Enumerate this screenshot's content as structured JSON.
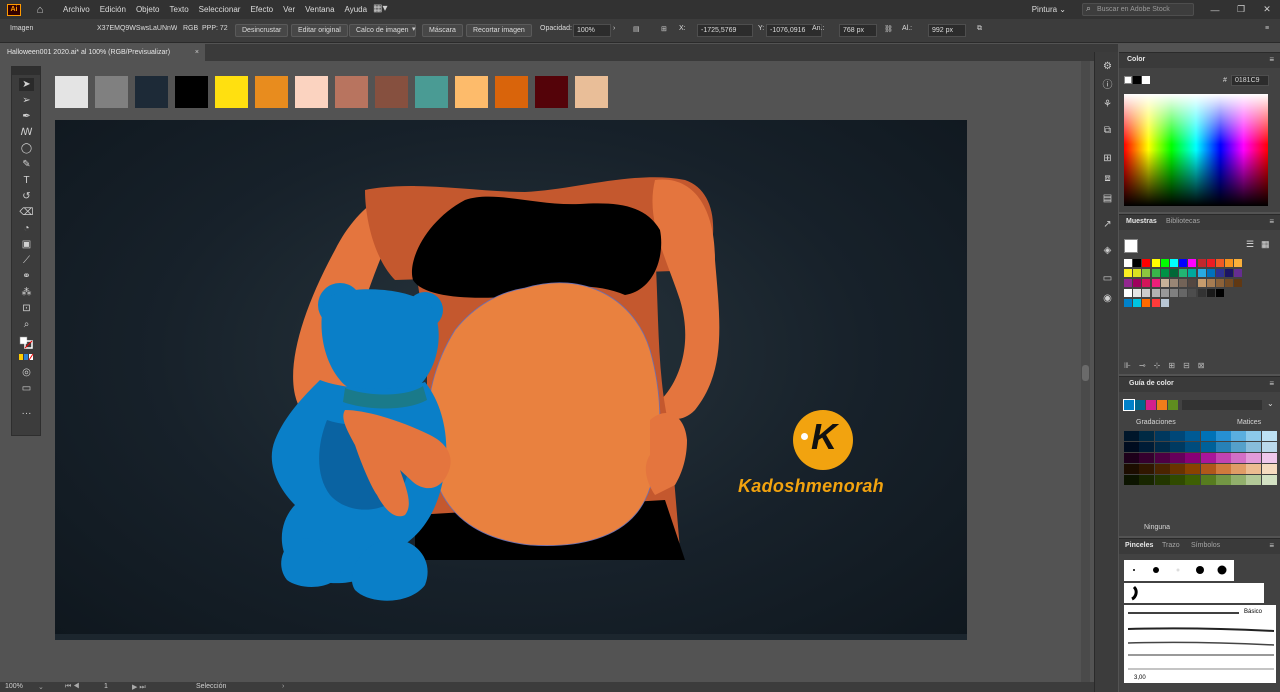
{
  "menubar": {
    "app_logo": "Ai",
    "items": [
      "Archivo",
      "Edición",
      "Objeto",
      "Texto",
      "Seleccionar",
      "Efecto",
      "Ver",
      "Ventana",
      "Ayuda"
    ],
    "workspace": "Pintura ⌄",
    "stock_placeholder": "Buscar en Adobe Stock",
    "window_buttons": [
      "—",
      "❐",
      "✕"
    ]
  },
  "controlbar": {
    "selection_type": "Imagen",
    "filename": "X37EMQ9WSwsLaUNnWj...",
    "color_mode": "RGB",
    "ppp": "PPP: 72",
    "embed_button": "Desincrustar",
    "edit_original_button": "Editar original",
    "trace_button": "Calco de imagen",
    "mask_button": "Máscara",
    "crop_button": "Recortar imagen",
    "opacity_label": "Opacidad:",
    "opacity_value": "100%",
    "x_label": "X:",
    "x_value": "-1725,5769",
    "y_label": "Y:",
    "y_value": "-1076,0916",
    "w_label": "An.:",
    "w_value": "768 px",
    "h_label": "Al.:",
    "h_value": "992 px"
  },
  "document_tab": {
    "title": "Halloween001 2020.ai* al 100% (RGB/Previsualizar)",
    "close": "×"
  },
  "tools": [
    "selection-tool",
    "direct-selection-tool",
    "pen-tool",
    "curvature-tool",
    "ellipse-tool",
    "pencil-tool",
    "type-tool",
    "rotate-tool",
    "eraser-tool",
    "shape-builder-tool",
    "gradient-tool",
    "eyedropper-tool",
    "blend-tool",
    "symbol-sprayer-tool",
    "artboard-tool",
    "zoom-tool",
    "fill-stroke",
    "color-mode",
    "draw-mode",
    "screen-mode",
    "more-tools"
  ],
  "artboard_swatches": [
    "#e4e4e4",
    "#808080",
    "#1d2a37",
    "#000000",
    "#ffe010",
    "#e88c1e",
    "#fbd3c0",
    "#b8745f",
    "#86503f",
    "#4a9b94",
    "#fdbb6b",
    "#d9640b",
    "#540309",
    "#e9be98"
  ],
  "illustration": {
    "brand_letter": "K",
    "brand_name": "Kadoshmenorah",
    "colors": {
      "skin": "#e4753e",
      "skin_shadow": "#c4582e",
      "belly": "#e9813f",
      "clothes": "#000000",
      "bear": "#0a7fc8",
      "bear_shadow": "#0a63a2",
      "brand": "#f2a30f"
    }
  },
  "statusbar": {
    "zoom": "100%",
    "artboard_number": "1",
    "tool_name": "Selección"
  },
  "color_panel": {
    "title": "Color",
    "hex_label": "#",
    "hex_value": "0181C9"
  },
  "swatches_panel": {
    "tab_active": "Muestras",
    "tab_inactive": "Bibliotecas",
    "rows": [
      [
        "#ffffff",
        "#000000",
        "#ff0000",
        "#ffff00",
        "#00ff00",
        "#00ffff",
        "#0000ff",
        "#ff00ff",
        "#c1272d",
        "#ed1c24",
        "#f15a24",
        "#f7931e",
        "#fbb03b"
      ],
      [
        "#fcee21",
        "#d9e021",
        "#8cc63f",
        "#39b54a",
        "#009245",
        "#006837",
        "#22b573",
        "#00a99d",
        "#29abe2",
        "#0071bc",
        "#2e3192",
        "#1b1464",
        "#662d91"
      ],
      [
        "#93278f",
        "#9e005d",
        "#d4145a",
        "#ed1e79",
        "#c7b299",
        "#998675",
        "#736357",
        "#534741",
        "#c69c6d",
        "#a67c52",
        "#8c6239",
        "#754c24",
        "#603813"
      ],
      [
        "#ffffff",
        "#e6e6e6",
        "#cccccc",
        "#b3b3b3",
        "#999999",
        "#808080",
        "#666666",
        "#4d4d4d",
        "#333333",
        "#1a1a1a",
        "#000000"
      ],
      [
        "#0081c9",
        "#00c4e0",
        "#ff6a00",
        "#ff3b3b",
        "#b8c6d4"
      ]
    ]
  },
  "color_guide_panel": {
    "title": "Guía de color",
    "gradations_label": "Gradaciones",
    "shades_label": "Matices",
    "none_label": "Ninguna",
    "harmony": [
      "#0081c9",
      "#00688f",
      "#d31f8b",
      "#ef7d1a",
      "#5f8d1f"
    ],
    "grid": [
      [
        "#00162a",
        "#002a44",
        "#00385e",
        "#004778",
        "#005a94",
        "#0072b6",
        "#2690d2",
        "#5aaedf",
        "#8cc9ea",
        "#bde1f3"
      ],
      [
        "#000c1f",
        "#001c36",
        "#002a48",
        "#003a61",
        "#004c7d",
        "#006199",
        "#2781b7",
        "#55a0ca",
        "#88bddb",
        "#bad9eb"
      ],
      [
        "#1d001a",
        "#35002e",
        "#4d0043",
        "#67005b",
        "#880076",
        "#a8169a",
        "#c143b2",
        "#d26fc6",
        "#e19bd9",
        "#efc8ec"
      ],
      [
        "#1c0d00",
        "#311700",
        "#4b2400",
        "#693300",
        "#8a4200",
        "#b0571a",
        "#d07a3d",
        "#e09c66",
        "#ecbc91",
        "#f6dbc0"
      ],
      [
        "#0c1400",
        "#182600",
        "#233600",
        "#304a00",
        "#3e5f03",
        "#577c1f",
        "#739744",
        "#92b06c",
        "#b3c998",
        "#d3e1c3"
      ]
    ]
  },
  "brushes_panel": {
    "tab_active": "Pinceles",
    "tab_trazo": "Trazo",
    "tab_symbols": "Símbolos",
    "basic_label": "Básico",
    "size_label": "3,00"
  }
}
